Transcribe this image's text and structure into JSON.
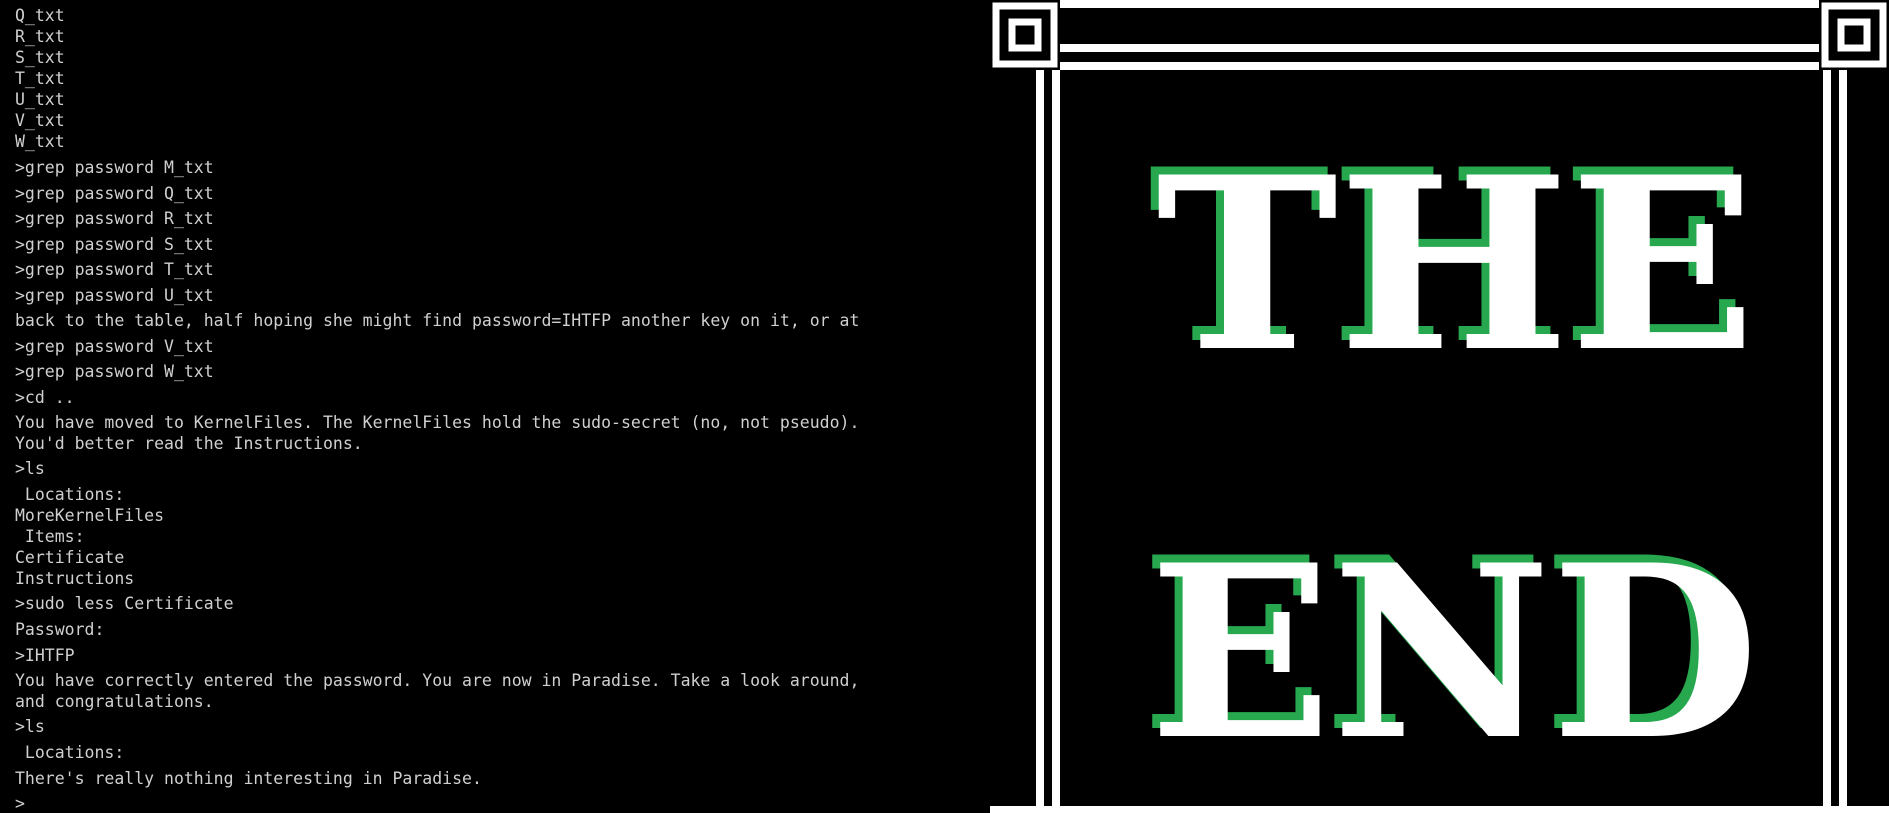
{
  "terminal": {
    "lines": [
      "Q_txt",
      "R_txt",
      "S_txt",
      "T_txt",
      "U_txt",
      "V_txt",
      "W_txt",
      ">grep password M_txt",
      ">grep password Q_txt",
      ">grep password R_txt",
      ">grep password S_txt",
      ">grep password T_txt",
      ">grep password U_txt",
      "back to the table, half hoping she might find password=IHTFP another key on it, or at",
      ">grep password V_txt",
      ">grep password W_txt",
      ">cd ..",
      "You have moved to KernelFiles. The KernelFiles hold the sudo-secret (no, not pseudo).",
      "You'd better read the Instructions.",
      ">ls",
      " Locations:",
      "MoreKernelFiles",
      " Items:",
      "Certificate",
      "Instructions",
      ">sudo less Certificate",
      "Password:",
      ">IHTFP",
      "You have correctly entered the password. You are now in Paradise. Take a look around,",
      "and congratulations.",
      ">ls",
      " Locations:",
      "There's really nothing interesting in Paradise.",
      ">"
    ]
  },
  "banner": {
    "line1": "THE",
    "line2": "END",
    "colors": {
      "text": "#ffffff",
      "shadow": "#27a84f",
      "frame": "#ffffff",
      "background": "#000000"
    }
  }
}
